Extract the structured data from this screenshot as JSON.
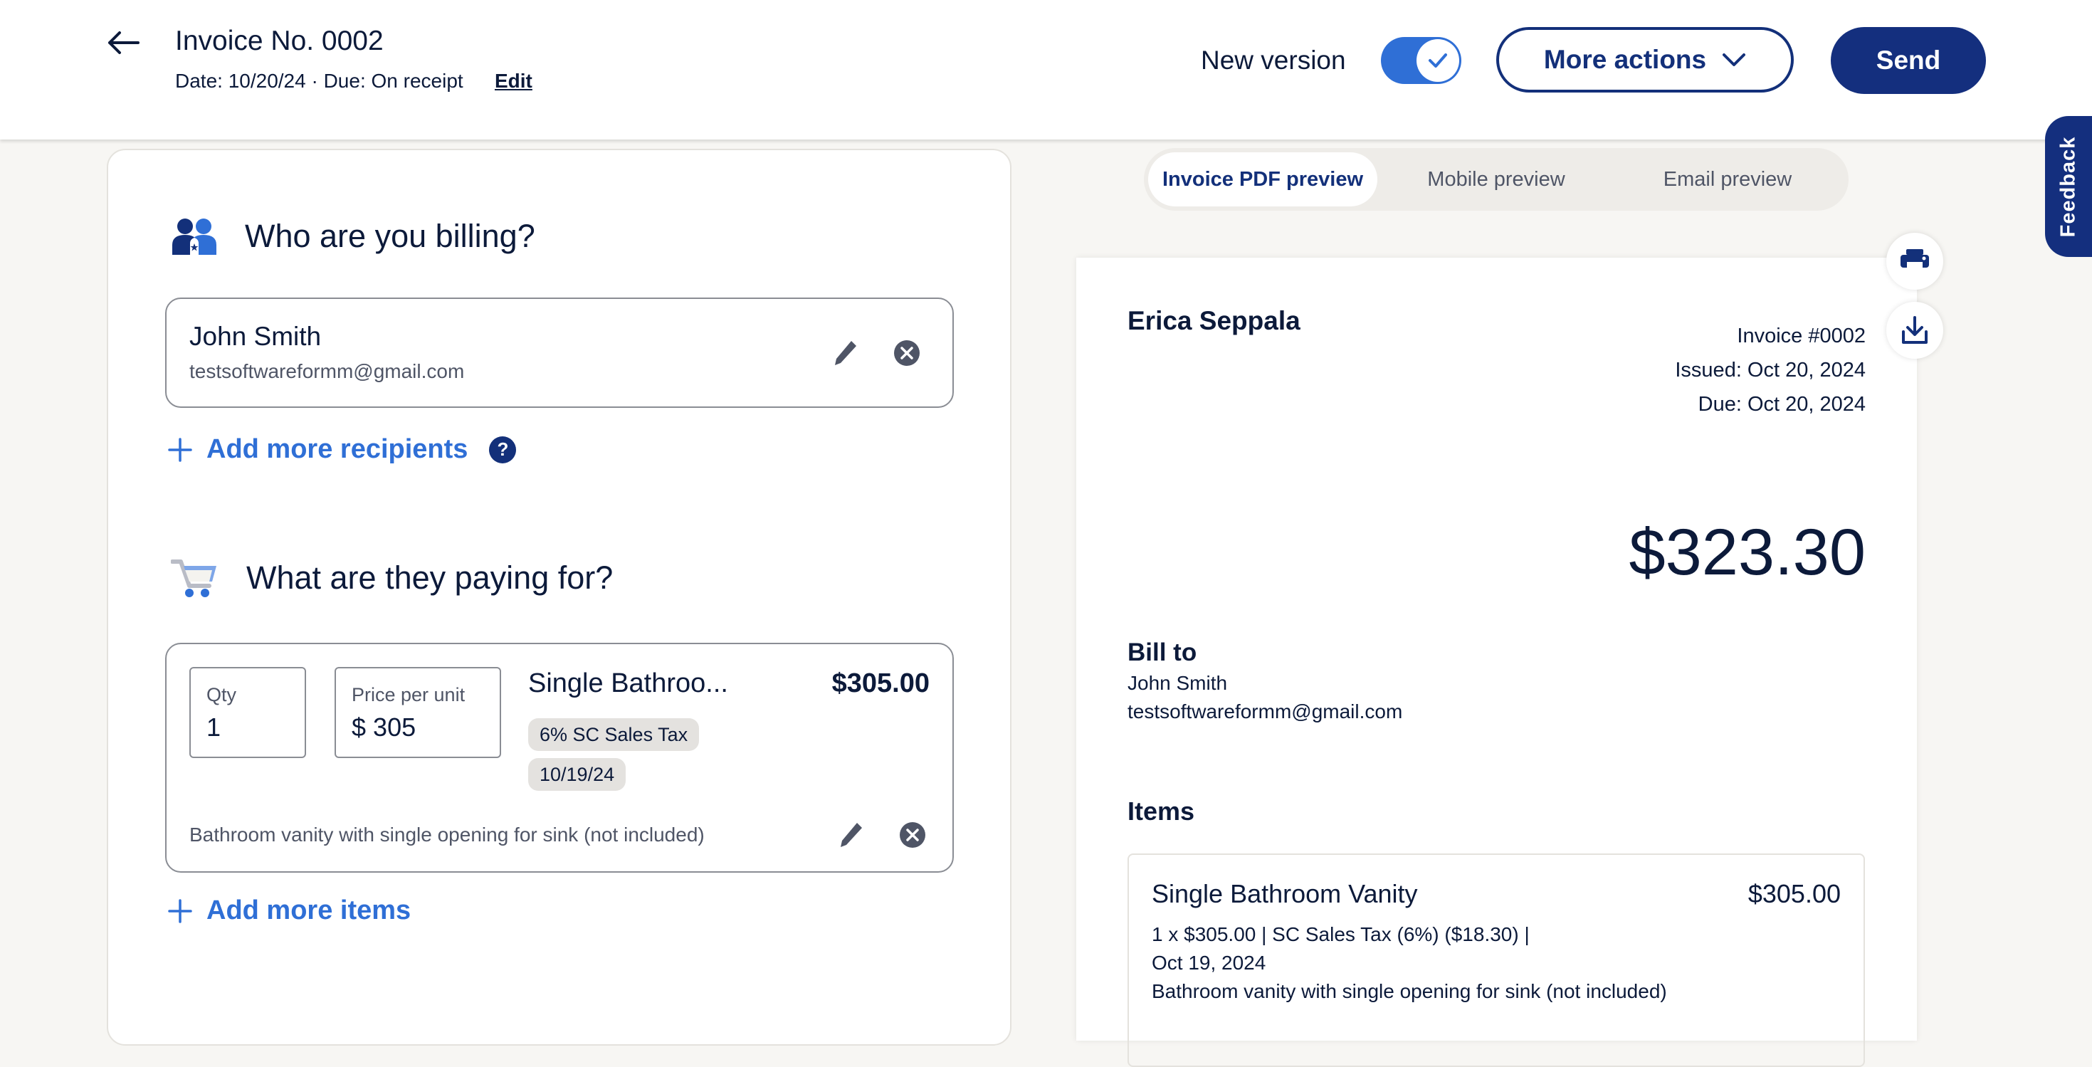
{
  "header": {
    "back_icon": "arrow-left-icon",
    "title": "Invoice No. 0002",
    "subtitle": "Date: 10/20/24 · Due: On receipt",
    "edit_label": "Edit",
    "new_version_label": "New version",
    "new_version_enabled": true,
    "more_actions_label": "More actions",
    "send_label": "Send"
  },
  "feedback_label": "Feedback",
  "billing": {
    "heading": "Who are you billing?",
    "icon": "people-icon",
    "recipient": {
      "name": "John Smith",
      "email": "testsoftwareformm@gmail.com"
    },
    "add_recipients_label": "Add more recipients",
    "help_icon_label": "?"
  },
  "items_section": {
    "heading": "What are they paying for?",
    "icon": "shopping-cart-icon",
    "items": [
      {
        "qty_label": "Qty",
        "qty_value": "1",
        "price_label": "Price per unit",
        "price_currency": "$",
        "price_value": "305",
        "name": "Single Bathroo...",
        "total": "$305.00",
        "chips": [
          "6% SC Sales Tax",
          "10/19/24"
        ],
        "description": "Bathroom vanity with single opening for sink (not included)"
      }
    ],
    "add_items_label": "Add more items"
  },
  "preview": {
    "tabs": [
      {
        "label": "Invoice PDF preview",
        "active": true
      },
      {
        "label": "Mobile preview",
        "active": false
      },
      {
        "label": "Email preview",
        "active": false
      }
    ],
    "print_icon": "print-icon",
    "download_icon": "download-icon",
    "doc": {
      "from_name": "Erica Seppala",
      "invoice_number": "Invoice #0002",
      "issued": "Issued: Oct 20, 2024",
      "due": "Due: Oct 20, 2024",
      "amount": "$323.30",
      "bill_to_heading": "Bill to",
      "bill_to_name": "John Smith",
      "bill_to_email": "testsoftwareformm@gmail.com",
      "items_heading": "Items",
      "items": [
        {
          "name": "Single Bathroom Vanity",
          "amount": "$305.00",
          "detail_line1": "1 x $305.00 | SC Sales Tax (6%) ($18.30) |",
          "detail_line2": "Oct 19, 2024",
          "description": "Bathroom vanity with single opening for sink (not included)"
        }
      ]
    }
  },
  "colors": {
    "brand_navy": "#142f7e",
    "accent_blue": "#2f6fd6",
    "text_dark": "#0c1a3a",
    "page_bg": "#f7f6f3"
  }
}
